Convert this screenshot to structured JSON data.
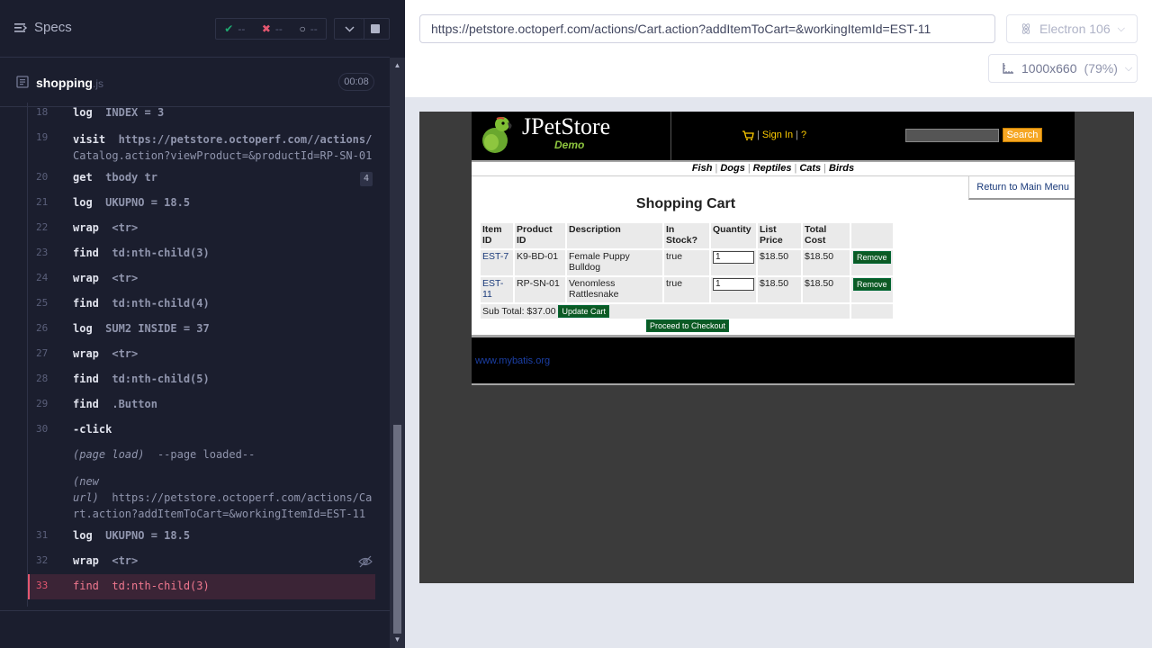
{
  "reporter": {
    "specs_label": "Specs",
    "stats": {
      "passed": "--",
      "failed": "--",
      "pending": "--"
    },
    "spec": {
      "name": "shopping",
      "ext": ".js",
      "duration": "00:08"
    },
    "commands": [
      {
        "num": "18",
        "name": "log",
        "msg": "INDEX = 3"
      },
      {
        "num": "19",
        "name": "visit",
        "msg": "https://petstore.octoperf.com//actions/",
        "msg2": "Catalog.action?viewProduct=&productId=RP-SN-01"
      },
      {
        "num": "20",
        "name": "get",
        "msg": "tbody tr",
        "badge": "4"
      },
      {
        "num": "21",
        "name": "log",
        "msg": "UKUPNO = 18.5"
      },
      {
        "num": "22",
        "name": "wrap",
        "msg": "<tr>"
      },
      {
        "num": "23",
        "name": "find",
        "msg": "td:nth-child(3)"
      },
      {
        "num": "24",
        "name": "wrap",
        "msg": "<tr>"
      },
      {
        "num": "25",
        "name": "find",
        "msg": "td:nth-child(4)"
      },
      {
        "num": "26",
        "name": "log",
        "msg": "SUM2 INSIDE = 37"
      },
      {
        "num": "27",
        "name": "wrap",
        "msg": "<tr>"
      },
      {
        "num": "28",
        "name": "find",
        "msg": "td:nth-child(5)"
      },
      {
        "num": "29",
        "name": "find",
        "msg": ".Button"
      },
      {
        "num": "30",
        "name": "-click",
        "msg": ""
      },
      {
        "num": "",
        "name": "(page load)",
        "msg": "--page loaded--"
      },
      {
        "num": "",
        "name": "(new",
        "name2": "url)",
        "msg": "https://petstore.octoperf.com/actions/Ca",
        "msg2": "rt.action?addItemToCart=&workingItemId=EST-11"
      },
      {
        "num": "31",
        "name": "log",
        "msg": "UKUPNO = 18.5"
      },
      {
        "num": "32",
        "name": "wrap",
        "msg": "<tr>"
      },
      {
        "num": "33",
        "name": "find",
        "msg": "td:nth-child(3)"
      }
    ]
  },
  "aut": {
    "url": "https://petstore.octoperf.com/actions/Cart.action?addItemToCart=&workingItemId=EST-11",
    "browser": "Electron 106",
    "viewport": "1000x660",
    "scale": "(79%)"
  },
  "petstore": {
    "logo": "JPetStore",
    "logo_sub": "Demo",
    "sign_in": "Sign In",
    "help": "?",
    "search_button": "Search",
    "menu": [
      "Fish",
      "Dogs",
      "Reptiles",
      "Cats",
      "Birds"
    ],
    "return_link": "Return to Main Menu",
    "cart_title": "Shopping Cart",
    "columns": [
      "Item ID",
      "Product ID",
      "Description",
      "In Stock?",
      "Quantity",
      "List Price",
      "Total Cost"
    ],
    "items": [
      {
        "item_id": "EST-7",
        "product_id": "K9-BD-01",
        "description": "Female Puppy Bulldog",
        "in_stock": "true",
        "quantity": "1",
        "list_price": "$18.50",
        "total": "$18.50",
        "remove": "Remove"
      },
      {
        "item_id": "EST-11",
        "product_id": "RP-SN-01",
        "description": "Venomless Rattlesnake",
        "in_stock": "true",
        "quantity": "1",
        "list_price": "$18.50",
        "total": "$18.50",
        "remove": "Remove"
      }
    ],
    "subtotal": "Sub Total: $37.00",
    "update_cart": "Update Cart",
    "checkout": "Proceed to Checkout",
    "footer_link": "www.mybatis.org"
  }
}
